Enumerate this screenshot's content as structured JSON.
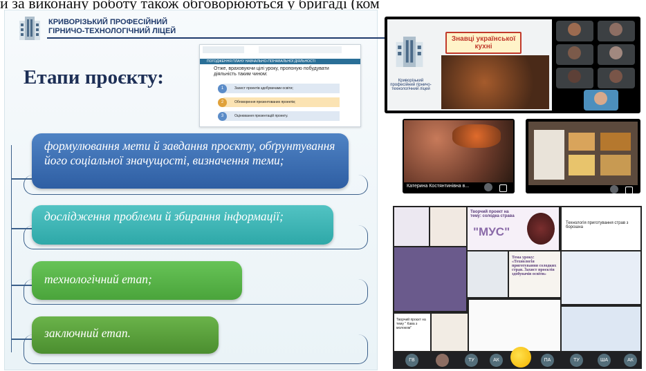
{
  "top_text": "и за виконану роботу також обговорюються у бригаді (ком",
  "slide": {
    "school_line1": "КРИВОРІЗЬКИЙ ПРОФЕСІЙНИЙ",
    "school_line2": "ГІРНИЧО-ТЕХНОЛОГІЧНИЙ ЛІЦЕЙ",
    "title": "Етапи проєкту:",
    "mini": {
      "header": "ПОГОДЖЕННЯ ПЛАНУ НАВЧАЛЬНО-ПІЗНАВАЛЬНОЇ ДІЯЛЬНОСТІ",
      "text": "Отже, враховуючи цілі уроку, пропоную побудувати діяльність таким чином:",
      "steps": [
        {
          "n": "1",
          "label": "Захист проектів здобувачами освіти;"
        },
        {
          "n": "2",
          "label": "Обговорення презентованих проектів;"
        },
        {
          "n": "3",
          "label": "Оцінювання презентацій проекту."
        }
      ]
    },
    "stages": [
      "формулювання мети й завдання проєкту, обґрунтування його соціальної значущості, визначення теми;",
      "дослідження проблеми й збирання інформації;",
      "технологічний етап;",
      "заключний етап."
    ]
  },
  "meeting": {
    "slide_title": "Знавці української кухні",
    "school_name": "Криворізький професійний гірничо-технологічний ліцей",
    "participants": [
      "ГВ",
      "ТУ",
      "АК",
      "ПА",
      "ТУ",
      "ША",
      "АК"
    ]
  },
  "screen2": {
    "caption": "Катерина Костянтинівна в..."
  },
  "collage": {
    "mus_title": "Творчий проект на тему: солодка страва",
    "mus_name": "\"МУС\"",
    "lesson": "Тема уроку: «Технологія приготування солодких страв. Захист проєктів здобувачів освіти»",
    "coffee": "Творчий проєкт на тему \" Кава з молоком\"",
    "topic_right": "Технологія приготування страв з борошна"
  }
}
